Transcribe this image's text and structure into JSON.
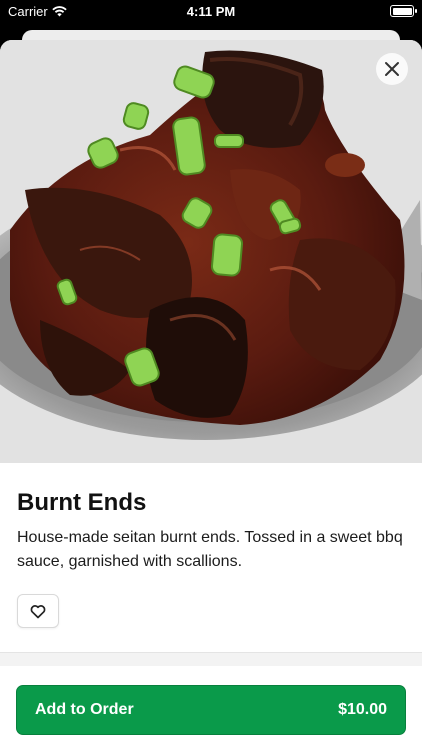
{
  "status_bar": {
    "carrier": "Carrier",
    "time": "4:11 PM"
  },
  "item": {
    "name": "Burnt Ends",
    "description": "House-made seitan burnt ends. Tossed in a sweet bbq sauce, garnished with scallions."
  },
  "order": {
    "add_label": "Add to Order",
    "price": "$10.00"
  },
  "icons": {
    "close": "close-icon",
    "favorite": "heart-icon",
    "wifi": "wifi-icon",
    "battery": "battery-icon"
  },
  "colors": {
    "accent": "#0a9a4a",
    "sauce": "#5a1b10",
    "scallion": "#7cc444"
  }
}
